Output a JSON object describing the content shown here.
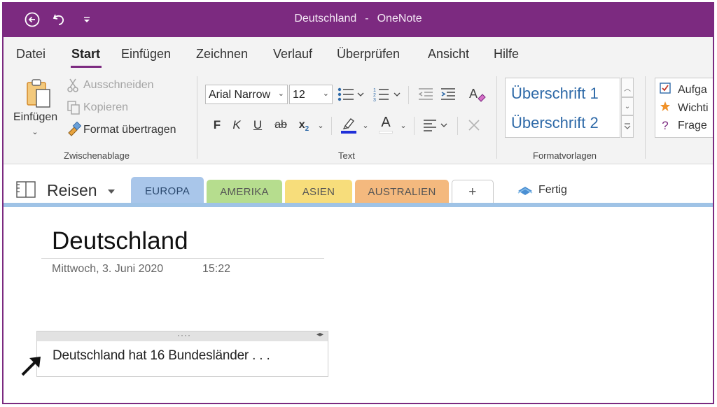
{
  "titlebar": {
    "title_page": "Deutschland",
    "title_sep": "-",
    "title_app": "OneNote",
    "icons": [
      "back-icon",
      "undo-icon",
      "customize-quick-access-icon"
    ]
  },
  "menu": {
    "items": [
      "Datei",
      "Start",
      "Einfügen",
      "Zeichnen",
      "Verlauf",
      "Überprüfen",
      "Ansicht",
      "Hilfe"
    ],
    "active": "Start"
  },
  "ribbon": {
    "clipboard": {
      "paste_label": "Einfügen",
      "cut_label": "Ausschneiden",
      "copy_label": "Kopieren",
      "format_painter_label": "Format übertragen",
      "group_label": "Zwischenablage"
    },
    "text": {
      "font_name": "Arial Narrow",
      "font_size": "12",
      "bold": "F",
      "italic": "K",
      "underline": "U",
      "strike": "ab",
      "subscript": "x",
      "subscript_suffix": "2",
      "font_color": "A",
      "group_label": "Text"
    },
    "styles": {
      "items": [
        "Überschrift 1",
        "Überschrift 2"
      ],
      "group_label": "Formatvorlagen"
    },
    "tags": {
      "items": [
        "Aufga",
        "Wichti",
        "Frage"
      ]
    }
  },
  "notebook": {
    "name": "Reisen",
    "tabs": [
      {
        "label": "EUROPA",
        "color": "#a9c6ea"
      },
      {
        "label": "AMERIKA",
        "color": "#b6dd8e"
      },
      {
        "label": "ASIEN",
        "color": "#f7dd7b"
      },
      {
        "label": "AUSTRALIEN",
        "color": "#f4b97e"
      }
    ],
    "add_tab": "+",
    "done_label": "Fertig"
  },
  "page": {
    "title": "Deutschland",
    "date": "Mittwoch, 3. Juni 2020",
    "time": "15:22",
    "note_text": "Deutschland hat 16 Bundesländer . . ."
  },
  "colors": {
    "accent": "#7c2a80",
    "ribbon_bg": "#f3f3f3",
    "section_line": "#9fc3e6"
  }
}
